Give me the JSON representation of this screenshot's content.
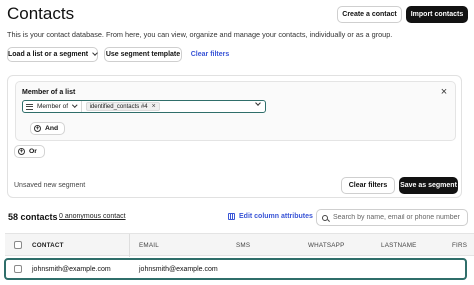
{
  "header": {
    "title": "Contacts",
    "description": "This is your contact database. From here, you can view, organize and manage your contacts, individually or as a group.",
    "create_label": "Create a contact",
    "import_label": "Import contacts"
  },
  "toolbar": {
    "load_label": "Load a list or a segment",
    "template_label": "Use segment template",
    "clear_label": "Clear filters"
  },
  "filter": {
    "title": "Member of a list",
    "operator": "Member of",
    "tag": "identified_contacts #4",
    "and_label": "And",
    "or_label": "Or"
  },
  "segment": {
    "status": "Unsaved new segment",
    "clear_label": "Clear filters",
    "save_label": "Save as segment"
  },
  "contacts": {
    "count": "58 contacts",
    "anon": "0 anonymous contact",
    "edit_columns": "Edit column attributes",
    "search_placeholder": "Search by name, email or phone number"
  },
  "table": {
    "columns": [
      "CONTACT",
      "EMAIL",
      "SMS",
      "WHATSAPP",
      "LASTNAME",
      "FIRS"
    ],
    "rows": [
      {
        "contact": "johnsmith@example.com",
        "email": "johnsmith@example.com"
      }
    ]
  },
  "colors": {
    "accent": "#2f6e6a",
    "link": "#3a55d6",
    "dark": "#121212"
  }
}
